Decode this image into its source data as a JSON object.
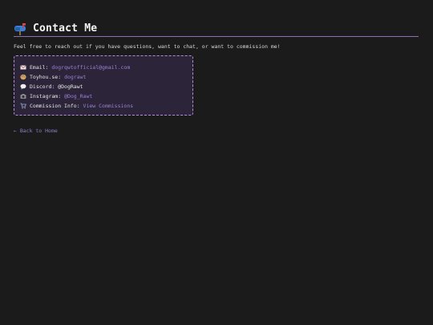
{
  "header": {
    "title": "Contact Me",
    "icon": "mailbox-icon"
  },
  "intro": "Feel free to reach out if you have questions, want to chat, or want to commission me!",
  "contacts": [
    {
      "icon": "envelope-icon",
      "label": "Email:",
      "value": "dogrqwtofficial@gmail.com",
      "is_link": true
    },
    {
      "icon": "palette-icon",
      "label": "Toyhou.se:",
      "value": "dograwt",
      "is_link": true
    },
    {
      "icon": "speech-bubble-icon",
      "label": "Discord:",
      "value": "@DogRawt",
      "is_link": false
    },
    {
      "icon": "camera-icon",
      "label": "Instagram:",
      "value": "@Dog_Rawt",
      "is_link": true
    },
    {
      "icon": "cart-icon",
      "label": "Commission Info:",
      "value": "View Commissions",
      "is_link": true
    }
  ],
  "back_link": "← Back to Home",
  "colors": {
    "background": "#1b1b1b",
    "accent": "#b18cd9",
    "link": "#9a82d4",
    "box_bg": "#2c2438"
  }
}
